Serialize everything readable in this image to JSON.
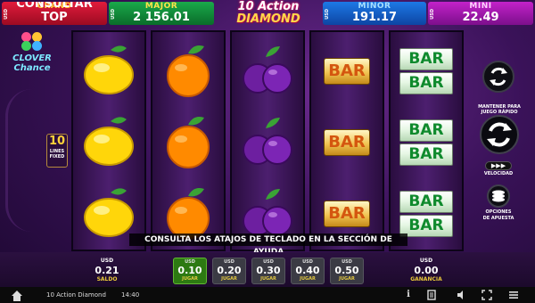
{
  "jackpots": {
    "grand": {
      "currency": "USD",
      "name": "GRAND",
      "value": "CONSULTAR TOP"
    },
    "major": {
      "currency": "USD",
      "name": "MAJOR",
      "value": "2 156.01"
    },
    "minor": {
      "currency": "USD",
      "name": "MINOR",
      "value": "191.17"
    },
    "mini": {
      "currency": "USD",
      "name": "MINI",
      "value": "22.49"
    }
  },
  "logo": {
    "line1": "10 Action",
    "line2": "DIAMOND"
  },
  "clover": {
    "line1": "CLOVER",
    "line2": "Chance"
  },
  "lines": {
    "count": "10",
    "label1": "LINES",
    "label2": "FIXED"
  },
  "reels": [
    [
      "lemon",
      "lemon",
      "lemon"
    ],
    [
      "orange",
      "orange",
      "orange"
    ],
    [
      "plum",
      "plum",
      "plum"
    ],
    [
      "bar",
      "bar",
      "bar"
    ],
    [
      "double-bar",
      "double-bar",
      "double-bar"
    ]
  ],
  "symbols": {
    "bar": "BAR"
  },
  "controls": {
    "spin_hint": "MANTENER PARA JUEGO RÁPIDO",
    "speed_label": "VELOCIDAD",
    "speed_icon": "▶▶▶",
    "bet_label1": "OPCIONES",
    "bet_label2": "DE APUESTA"
  },
  "message": "CONSULTA LOS ATAJOS DE TECLADO EN LA SECCIÓN DE AYUDA",
  "bottom": {
    "saldo": {
      "currency": "USD",
      "value": "0.21",
      "label": "SALDO"
    },
    "ganancia": {
      "currency": "USD",
      "value": "0.00",
      "label": "GANANCIA"
    },
    "bet_options": [
      {
        "currency": "USD",
        "value": "0.10",
        "label": "JUGAR",
        "selected": true
      },
      {
        "currency": "USD",
        "value": "0.20",
        "label": "JUGAR",
        "selected": false
      },
      {
        "currency": "USD",
        "value": "0.30",
        "label": "JUGAR",
        "selected": false
      },
      {
        "currency": "USD",
        "value": "0.40",
        "label": "JUGAR",
        "selected": false
      },
      {
        "currency": "USD",
        "value": "0.50",
        "label": "JUGAR",
        "selected": false
      }
    ]
  },
  "statusbar": {
    "home_icon": "home-icon",
    "game_name": "10 Action Diamond",
    "time": "14:40",
    "icons": [
      "info-icon",
      "paytable-icon",
      "volume-icon",
      "fullscreen-icon",
      "menu-icon"
    ],
    "info_glyph": "i"
  },
  "colors": {
    "grand": "#e11b3b",
    "major": "#1aa94a",
    "minor": "#1d79e6",
    "mini": "#c322c9",
    "selected_bet": "#2d7a12",
    "accent_gold": "#e9c83a"
  }
}
